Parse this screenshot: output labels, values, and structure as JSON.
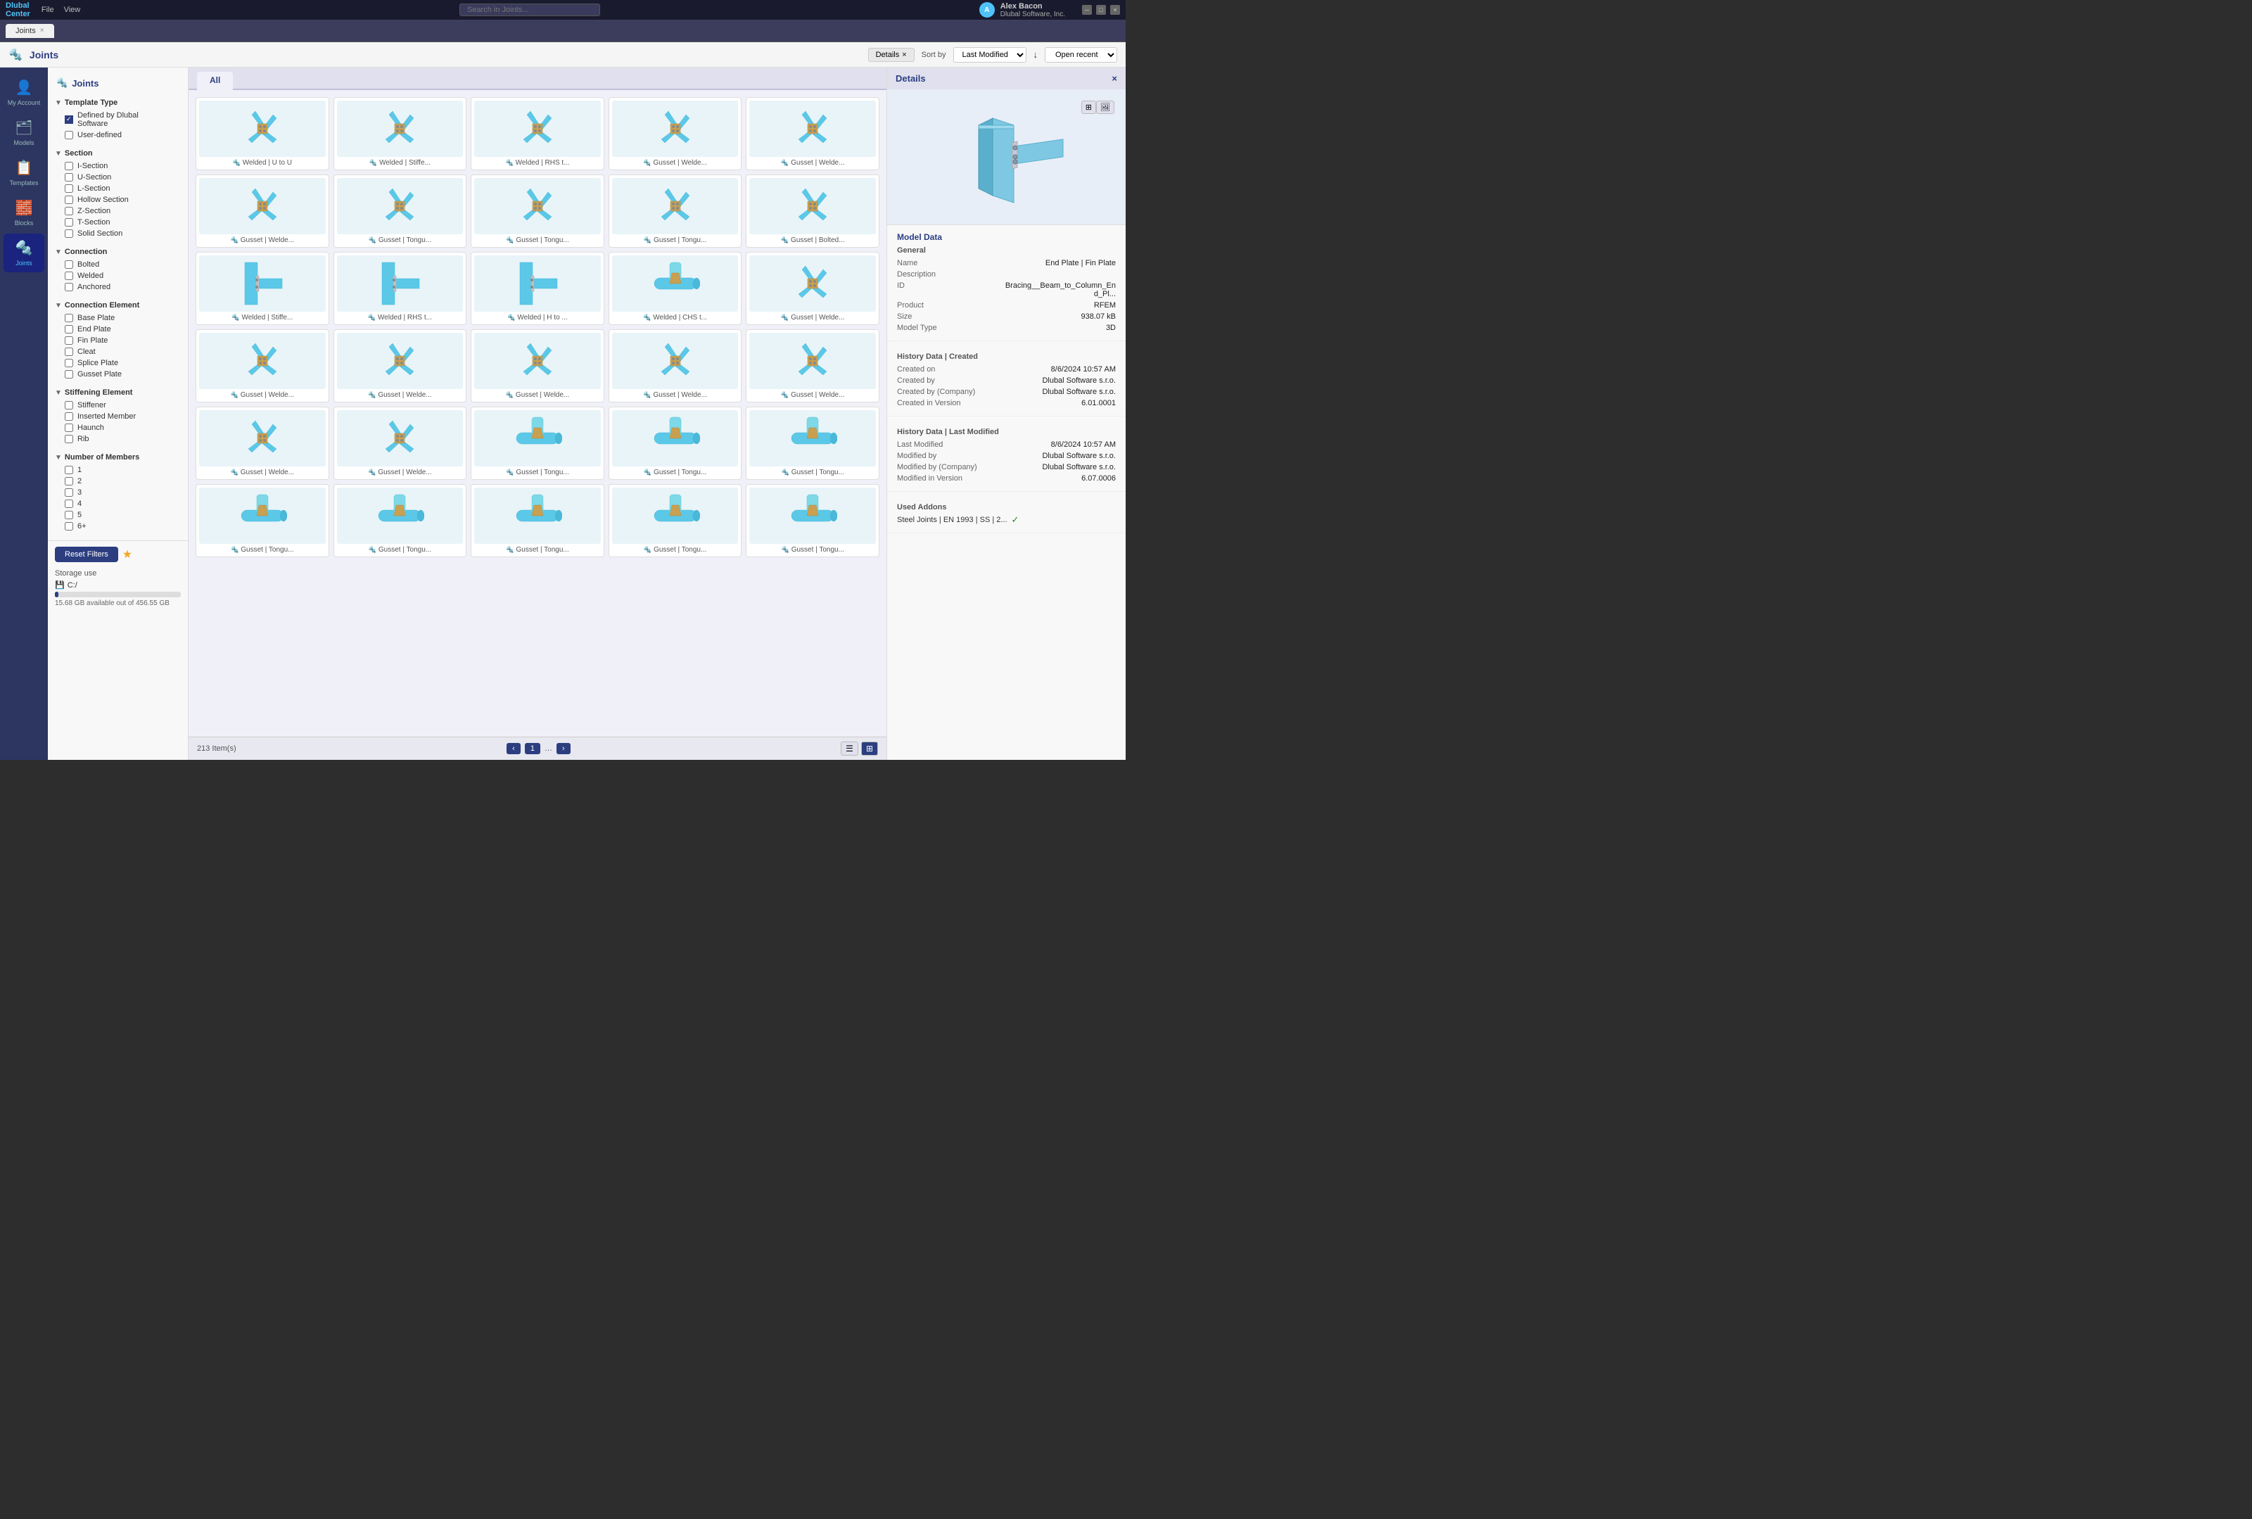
{
  "titlebar": {
    "logo_line1": "Dlubal",
    "logo_line2": "Center",
    "menu": [
      "File",
      "View"
    ],
    "search_placeholder": "Search in Joints...",
    "user_name": "Alex Bacon",
    "user_company": "Dlubal Software, Inc.",
    "user_initials": "A"
  },
  "tab": {
    "label": "Joints",
    "close": "×"
  },
  "toolbar": {
    "title": "Joints",
    "details_label": "Details",
    "sort_label": "Sort by",
    "sort_value": "Last Modified",
    "open_recent": "Open recent"
  },
  "left_nav": {
    "items": [
      {
        "id": "my-account",
        "label": "My Account",
        "icon": "👤"
      },
      {
        "id": "models",
        "label": "Models",
        "icon": "🗂"
      },
      {
        "id": "templates",
        "label": "Templates",
        "icon": "📋"
      },
      {
        "id": "blocks",
        "label": "Blocks",
        "icon": "🧱"
      },
      {
        "id": "joints",
        "label": "Joints",
        "icon": "🔩",
        "active": true
      }
    ]
  },
  "sidebar": {
    "title": "Joints",
    "sections": [
      {
        "id": "template-type",
        "label": "Template Type",
        "expanded": true,
        "items": [
          {
            "id": "defined-by-dlubal",
            "label": "Defined by Dlubal Software",
            "checked": true
          },
          {
            "id": "user-defined",
            "label": "User-defined",
            "checked": false
          }
        ]
      },
      {
        "id": "section",
        "label": "Section",
        "expanded": true,
        "items": [
          {
            "id": "i-section",
            "label": "I-Section",
            "checked": false
          },
          {
            "id": "u-section",
            "label": "U-Section",
            "checked": false
          },
          {
            "id": "l-section",
            "label": "L-Section",
            "checked": false
          },
          {
            "id": "hollow-section",
            "label": "Hollow Section",
            "checked": false
          },
          {
            "id": "z-section",
            "label": "Z-Section",
            "checked": false
          },
          {
            "id": "t-section",
            "label": "T-Section",
            "checked": false
          },
          {
            "id": "solid-section",
            "label": "Solid Section",
            "checked": false
          }
        ]
      },
      {
        "id": "connection",
        "label": "Connection",
        "expanded": true,
        "items": [
          {
            "id": "bolted",
            "label": "Bolted",
            "checked": false
          },
          {
            "id": "welded",
            "label": "Welded",
            "checked": false
          },
          {
            "id": "anchored",
            "label": "Anchored",
            "checked": false
          }
        ]
      },
      {
        "id": "connection-element",
        "label": "Connection Element",
        "expanded": true,
        "items": [
          {
            "id": "base-plate",
            "label": "Base Plate",
            "checked": false
          },
          {
            "id": "end-plate",
            "label": "End Plate",
            "checked": false
          },
          {
            "id": "fin-plate",
            "label": "Fin Plate",
            "checked": false
          },
          {
            "id": "cleat",
            "label": "Cleat",
            "checked": false
          },
          {
            "id": "splice-plate",
            "label": "Splice Plate",
            "checked": false
          },
          {
            "id": "gusset-plate",
            "label": "Gusset Plate",
            "checked": false
          }
        ]
      },
      {
        "id": "stiffening-element",
        "label": "Stiffening Element",
        "expanded": true,
        "items": [
          {
            "id": "stiffener",
            "label": "Stiffener",
            "checked": false
          },
          {
            "id": "inserted-member",
            "label": "Inserted Member",
            "checked": false
          },
          {
            "id": "haunch",
            "label": "Haunch",
            "checked": false
          },
          {
            "id": "rib",
            "label": "Rib",
            "checked": false
          }
        ]
      },
      {
        "id": "number-of-members",
        "label": "Number of Members",
        "expanded": true,
        "items": [
          {
            "id": "1",
            "label": "1",
            "checked": false
          },
          {
            "id": "2",
            "label": "2",
            "checked": false
          },
          {
            "id": "3",
            "label": "3",
            "checked": false
          },
          {
            "id": "4",
            "label": "4",
            "checked": false
          },
          {
            "id": "5",
            "label": "5",
            "checked": false
          },
          {
            "id": "6plus",
            "label": "6+",
            "checked": false
          }
        ]
      }
    ],
    "reset_label": "Reset Filters",
    "storage_label": "Storage use",
    "drive": "C:/",
    "storage_used_gb": "15.68",
    "storage_total_gb": "456.55",
    "storage_text": "15.68 GB available out of 456.55 GB",
    "storage_pct": 3
  },
  "content": {
    "tabs": [
      {
        "id": "all",
        "label": "All",
        "active": true
      }
    ],
    "items": [
      {
        "id": 1,
        "label": "Welded | U to U",
        "type": "gusset"
      },
      {
        "id": 2,
        "label": "Welded | Stiffe...",
        "type": "gusset"
      },
      {
        "id": 3,
        "label": "Welded | RHS t...",
        "type": "gusset"
      },
      {
        "id": 4,
        "label": "Gusset | Welde...",
        "type": "gusset"
      },
      {
        "id": 5,
        "label": "Gusset | Welde...",
        "type": "gusset"
      },
      {
        "id": 6,
        "label": "Gusset | Welde...",
        "type": "gusset"
      },
      {
        "id": 7,
        "label": "Gusset | Tongu...",
        "type": "gusset"
      },
      {
        "id": 8,
        "label": "Gusset | Tongu...",
        "type": "gusset"
      },
      {
        "id": 9,
        "label": "Gusset | Tongu...",
        "type": "gusset"
      },
      {
        "id": 10,
        "label": "Gusset | Bolted...",
        "type": "gusset"
      },
      {
        "id": 11,
        "label": "Welded | Stiffe...",
        "type": "beam"
      },
      {
        "id": 12,
        "label": "Welded | RHS t...",
        "type": "beam"
      },
      {
        "id": 13,
        "label": "Welded | H to ...",
        "type": "beam"
      },
      {
        "id": 14,
        "label": "Welded | CHS t...",
        "type": "pipe"
      },
      {
        "id": 15,
        "label": "Gusset | Welde...",
        "type": "gusset"
      },
      {
        "id": 16,
        "label": "Gusset | Welde...",
        "type": "gusset"
      },
      {
        "id": 17,
        "label": "Gusset | Welde...",
        "type": "gusset"
      },
      {
        "id": 18,
        "label": "Gusset | Welde...",
        "type": "gusset"
      },
      {
        "id": 19,
        "label": "Gusset | Welde...",
        "type": "gusset"
      },
      {
        "id": 20,
        "label": "Gusset | Welde...",
        "type": "gusset"
      },
      {
        "id": 21,
        "label": "Gusset | Welde...",
        "type": "gusset"
      },
      {
        "id": 22,
        "label": "Gusset | Welde...",
        "type": "gusset"
      },
      {
        "id": 23,
        "label": "Gusset | Tongu...",
        "type": "pipe"
      },
      {
        "id": 24,
        "label": "Gusset | Tongu...",
        "type": "pipe"
      },
      {
        "id": 25,
        "label": "Gusset | Tongu...",
        "type": "pipe"
      },
      {
        "id": 26,
        "label": "Gusset | Tongu...",
        "type": "pipe"
      },
      {
        "id": 27,
        "label": "Gusset | Tongu...",
        "type": "pipe"
      },
      {
        "id": 28,
        "label": "Gusset | Tongu...",
        "type": "pipe"
      },
      {
        "id": 29,
        "label": "Gusset | Tongu...",
        "type": "pipe"
      },
      {
        "id": 30,
        "label": "Gusset | Tongu...",
        "type": "pipe"
      }
    ],
    "count_label": "213 Item(s)"
  },
  "details": {
    "title": "Details",
    "close": "×",
    "model_data_title": "Model Data",
    "general": {
      "title": "General",
      "name_label": "Name",
      "name_value": "End Plate | Fin Plate",
      "description_label": "Description",
      "description_value": "",
      "id_label": "ID",
      "id_value": "Bracing__Beam_to_Column_End_Pl...",
      "product_label": "Product",
      "product_value": "RFEM",
      "size_label": "Size",
      "size_value": "938.07 kB",
      "model_type_label": "Model Type",
      "model_type_value": "3D"
    },
    "history_created": {
      "title": "History Data | Created",
      "created_on_label": "Created on",
      "created_on_value": "8/6/2024 10:57 AM",
      "created_by_label": "Created by",
      "created_by_value": "Dlubal Software s.r.o.",
      "created_by_company_label": "Created by (Company)",
      "created_by_company_value": "Dlubal Software s.r.o.",
      "created_in_version_label": "Created in Version",
      "created_in_version_value": "6.01.0001"
    },
    "history_modified": {
      "title": "History Data | Last Modified",
      "last_modified_label": "Last Modified",
      "last_modified_value": "8/6/2024 10:57 AM",
      "modified_by_label": "Modified by",
      "modified_by_value": "Dlubal Software s.r.o.",
      "modified_by_company_label": "Modified by (Company)",
      "modified_by_company_value": "Dlubal Software s.r.o.",
      "modified_in_version_label": "Modified in Version",
      "modified_in_version_value": "6.07.0006"
    },
    "used_addons": {
      "title": "Used Addons",
      "addon_label": "Steel Joints | EN 1993 | SS | 2...",
      "addon_check": "✓"
    }
  }
}
